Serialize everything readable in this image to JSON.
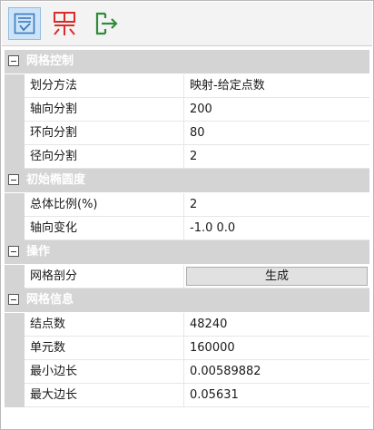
{
  "toolbar": {
    "buttons": [
      {
        "name": "edit-list-icon",
        "active": true
      },
      {
        "name": "grid-red-icon",
        "active": false
      },
      {
        "name": "export-icon",
        "active": false
      }
    ]
  },
  "sections": {
    "mesh_control": {
      "title": "网格控制",
      "rows": [
        {
          "label": "划分方法",
          "value": "映射-给定点数"
        },
        {
          "label": "轴向分割",
          "value": "200"
        },
        {
          "label": "环向分割",
          "value": "80"
        },
        {
          "label": "径向分割",
          "value": "2"
        }
      ]
    },
    "initial_ellipticity": {
      "title": "初始椭圆度",
      "rows": [
        {
          "label": "总体比例(%)",
          "value": "2"
        },
        {
          "label": "轴向变化",
          "value": "-1.0 0.0"
        }
      ]
    },
    "operation": {
      "title": "操作",
      "rows": [
        {
          "label": "网格剖分",
          "button": "生成"
        }
      ]
    },
    "mesh_info": {
      "title": "网格信息",
      "rows": [
        {
          "label": "结点数",
          "value": "48240"
        },
        {
          "label": "单元数",
          "value": "160000"
        },
        {
          "label": "最小边长",
          "value": "0.00589882"
        },
        {
          "label": "最大边长",
          "value": "0.05631"
        }
      ]
    }
  },
  "colors": {
    "category_bg": "#d4d4d4",
    "toolbar_active": "#cde4f7",
    "accent_red": "#d92b2b",
    "accent_green": "#2e8b3a",
    "accent_blue": "#3a78c2"
  }
}
